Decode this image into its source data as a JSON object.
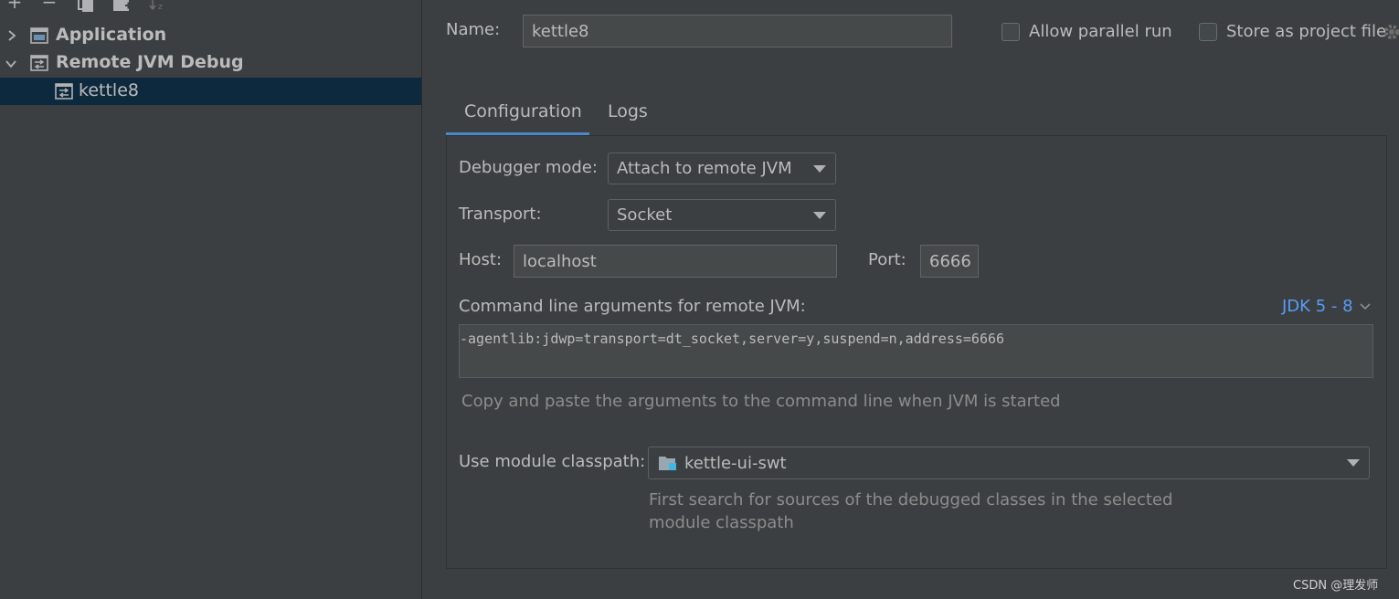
{
  "left_panel": {
    "toolbar": {
      "add_icon": "plus-icon",
      "remove_icon": "minus-icon",
      "copy_icon": "copy-icon",
      "folder_icon": "new-folder-icon",
      "sort_icon": "sort-icon"
    },
    "tree": [
      {
        "label": "Application",
        "expanded": false,
        "bold": true,
        "icon": "application-icon"
      },
      {
        "label": "Remote JVM Debug",
        "expanded": true,
        "bold": true,
        "icon": "remote-debug-icon"
      },
      {
        "label": "kettle8",
        "selected": true,
        "icon": "remote-debug-icon"
      }
    ]
  },
  "header": {
    "name_label": "Name:",
    "name_value": "kettle8",
    "allow_parallel_label": "Allow parallel run",
    "allow_parallel_checked": false,
    "store_project_label": "Store as project file",
    "store_project_checked": false
  },
  "tabs": [
    {
      "label": "Configuration",
      "active": true
    },
    {
      "label": "Logs",
      "active": false
    }
  ],
  "config": {
    "debugger_mode_label": "Debugger mode:",
    "debugger_mode_value": "Attach to remote JVM",
    "transport_label": "Transport:",
    "transport_value": "Socket",
    "host_label": "Host:",
    "host_value": "localhost",
    "port_label": "Port:",
    "port_value": "6666",
    "cmdline_label": "Command line arguments for remote JVM:",
    "jdk_selector": "JDK 5 - 8",
    "cmdline_value": "-agentlib:jdwp=transport=dt_socket,server=y,suspend=n,address=6666",
    "cmdline_hint": "Copy and paste the arguments to the command line when JVM is started",
    "module_label": "Use module classpath:",
    "module_value": "kettle-ui-swt",
    "module_hint_line1": "First search for sources of the debugged classes in the selected",
    "module_hint_line2": "module classpath"
  },
  "watermark": "CSDN @理发师",
  "colors": {
    "background": "#3c3f41",
    "selection": "#0d293e",
    "accent": "#4a88c7",
    "link": "#589df6"
  }
}
